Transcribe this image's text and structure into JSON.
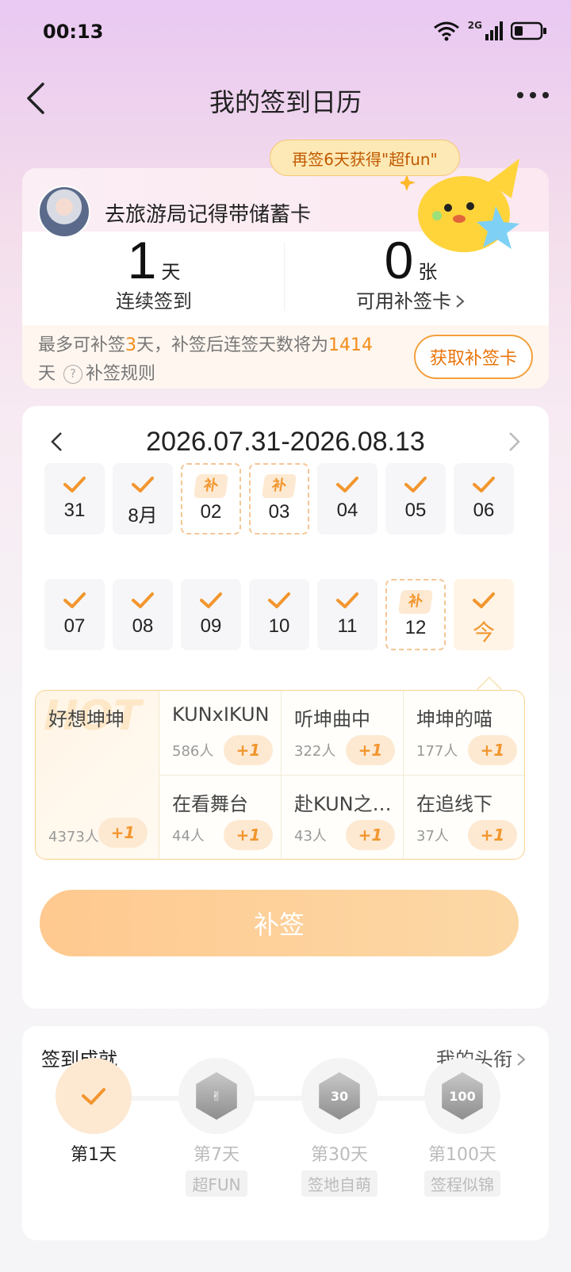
{
  "status": {
    "time": "00:13",
    "network": "2G"
  },
  "nav": {
    "title": "我的签到日历"
  },
  "bubble": {
    "text": "再签6天获得\"超fun\""
  },
  "profile": {
    "name": "去旅游局记得带储蓄卡"
  },
  "stats": {
    "streak_value": "1",
    "streak_unit": "天",
    "streak_label": "连续签到",
    "cards_value": "0",
    "cards_unit": "张",
    "cards_label": "可用补签卡"
  },
  "makeup_info": {
    "prefix": "最多可补签",
    "days": "3",
    "mid": "天，补签后连签天数将为",
    "total": "1414",
    "suffix": "天",
    "rules_label": "补签规则",
    "get_button": "获取补签卡"
  },
  "calendar": {
    "range": "2026.07.31-2026.08.13",
    "makeup_tag": "补",
    "days": [
      {
        "label": "31",
        "state": "signed"
      },
      {
        "label": "8月",
        "state": "signed"
      },
      {
        "label": "02",
        "state": "makeup"
      },
      {
        "label": "03",
        "state": "makeup"
      },
      {
        "label": "04",
        "state": "signed"
      },
      {
        "label": "05",
        "state": "signed"
      },
      {
        "label": "06",
        "state": "signed"
      },
      {
        "label": "07",
        "state": "signed"
      },
      {
        "label": "08",
        "state": "signed"
      },
      {
        "label": "09",
        "state": "signed"
      },
      {
        "label": "10",
        "state": "signed"
      },
      {
        "label": "11",
        "state": "signed"
      },
      {
        "label": "12",
        "state": "makeup"
      },
      {
        "label": "今",
        "state": "today"
      }
    ]
  },
  "topics": {
    "hot_watermark": "HOT",
    "plus_label": "+1",
    "hot": {
      "name": "好想坤坤",
      "count": "4373人"
    },
    "items": [
      {
        "name": "KUNxIKUN",
        "count": "586人"
      },
      {
        "name": "听坤曲中",
        "count": "322人"
      },
      {
        "name": "坤坤的喵",
        "count": "177人"
      },
      {
        "name": "在看舞台",
        "count": "44人"
      },
      {
        "name": "赴KUN之…",
        "count": "43人"
      },
      {
        "name": "在追线下",
        "count": "37人"
      }
    ]
  },
  "makeup_button": "补签",
  "achievements": {
    "title": "签到成就",
    "link": "我的头衔",
    "badges": [
      {
        "day": "第1天",
        "name": "",
        "done": true
      },
      {
        "day": "第7天",
        "name": "超FUN",
        "done": false
      },
      {
        "day": "第30天",
        "name": "签地自萌",
        "done": false
      },
      {
        "day": "第100天",
        "name": "签程似锦",
        "done": false
      }
    ]
  },
  "colors": {
    "accent": "#F2962E",
    "accent_light": "#FDE9D2"
  }
}
